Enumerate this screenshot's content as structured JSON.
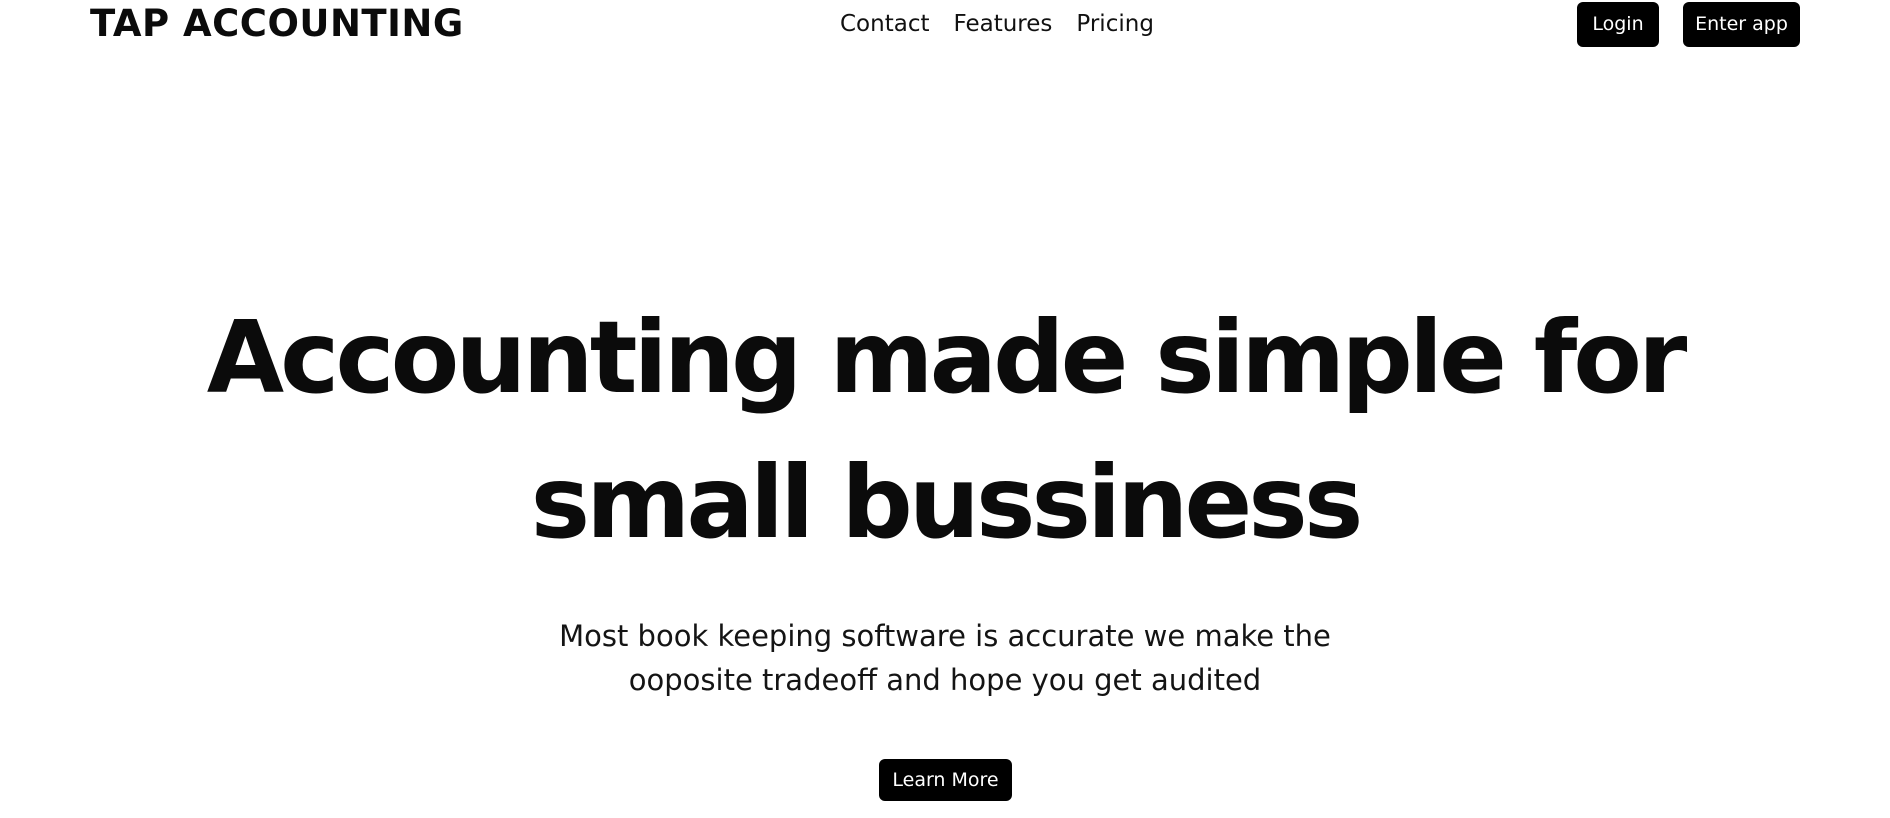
{
  "header": {
    "brand": "TAP ACCOUNTING",
    "nav": [
      {
        "label": "Contact"
      },
      {
        "label": "Features"
      },
      {
        "label": "Pricing"
      }
    ],
    "login_label": "Login",
    "enter_app_label": "Enter app"
  },
  "hero": {
    "title": "Accounting made simple for small bussiness",
    "subtitle": "Most book keeping software is accurate we make the ooposite tradeoff and hope you get audited",
    "cta_label": "Learn More"
  },
  "colors": {
    "background": "#ffffff",
    "text": "#0b0b0b",
    "button_bg": "#000000",
    "button_text": "#ffffff"
  }
}
